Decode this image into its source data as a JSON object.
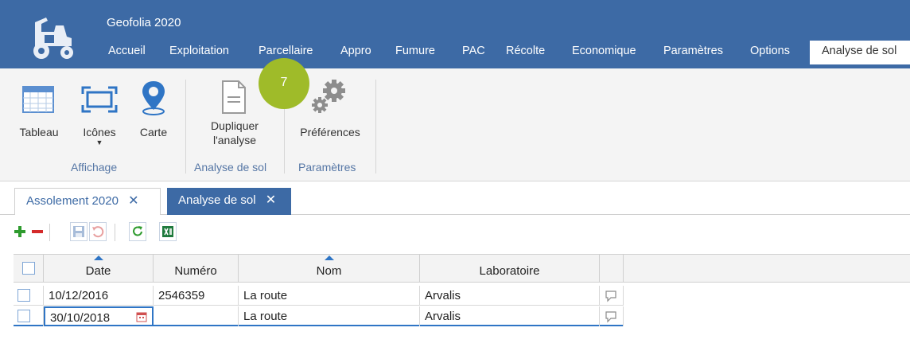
{
  "app": {
    "title": "Geofolia 2020"
  },
  "menu": {
    "items": [
      {
        "label": "Accueil"
      },
      {
        "label": "Exploitation"
      },
      {
        "label": "Parcellaire"
      },
      {
        "label": "Appro"
      },
      {
        "label": "Fumure"
      },
      {
        "label": "PAC"
      },
      {
        "label": "Récolte"
      },
      {
        "label": "Economique"
      },
      {
        "label": "Paramètres"
      },
      {
        "label": "Options"
      },
      {
        "label": "Analyse de sol"
      }
    ]
  },
  "ribbon": {
    "tableau": "Tableau",
    "icones": "Icônes",
    "carte": "Carte",
    "dupliquer_line1": "Dupliquer",
    "dupliquer_line2": "l'analyse",
    "preferences": "Préférences",
    "groups": {
      "affichage": "Affichage",
      "analyse": "Analyse de sol",
      "parametres": "Paramètres"
    }
  },
  "badge": "7",
  "tabs": [
    {
      "label": "Assolement 2020",
      "close": "✕"
    },
    {
      "label": "Analyse de sol",
      "close": "✕"
    }
  ],
  "colors": {
    "brand": "#3d6aa5",
    "badge": "#9fbb29",
    "add": "#2e9b2e",
    "remove": "#d42a2a",
    "refresh": "#2e9b2e",
    "excel": "#1f7a3d"
  },
  "table": {
    "columns": [
      "Date",
      "Numéro",
      "Nom",
      "Laboratoire"
    ],
    "rows": [
      {
        "date": "10/12/2016",
        "numero": "2546359",
        "nom": "La route",
        "laboratoire": "Arvalis"
      },
      {
        "date": "30/10/2018",
        "numero": "",
        "nom": "La route",
        "laboratoire": "Arvalis"
      }
    ]
  }
}
